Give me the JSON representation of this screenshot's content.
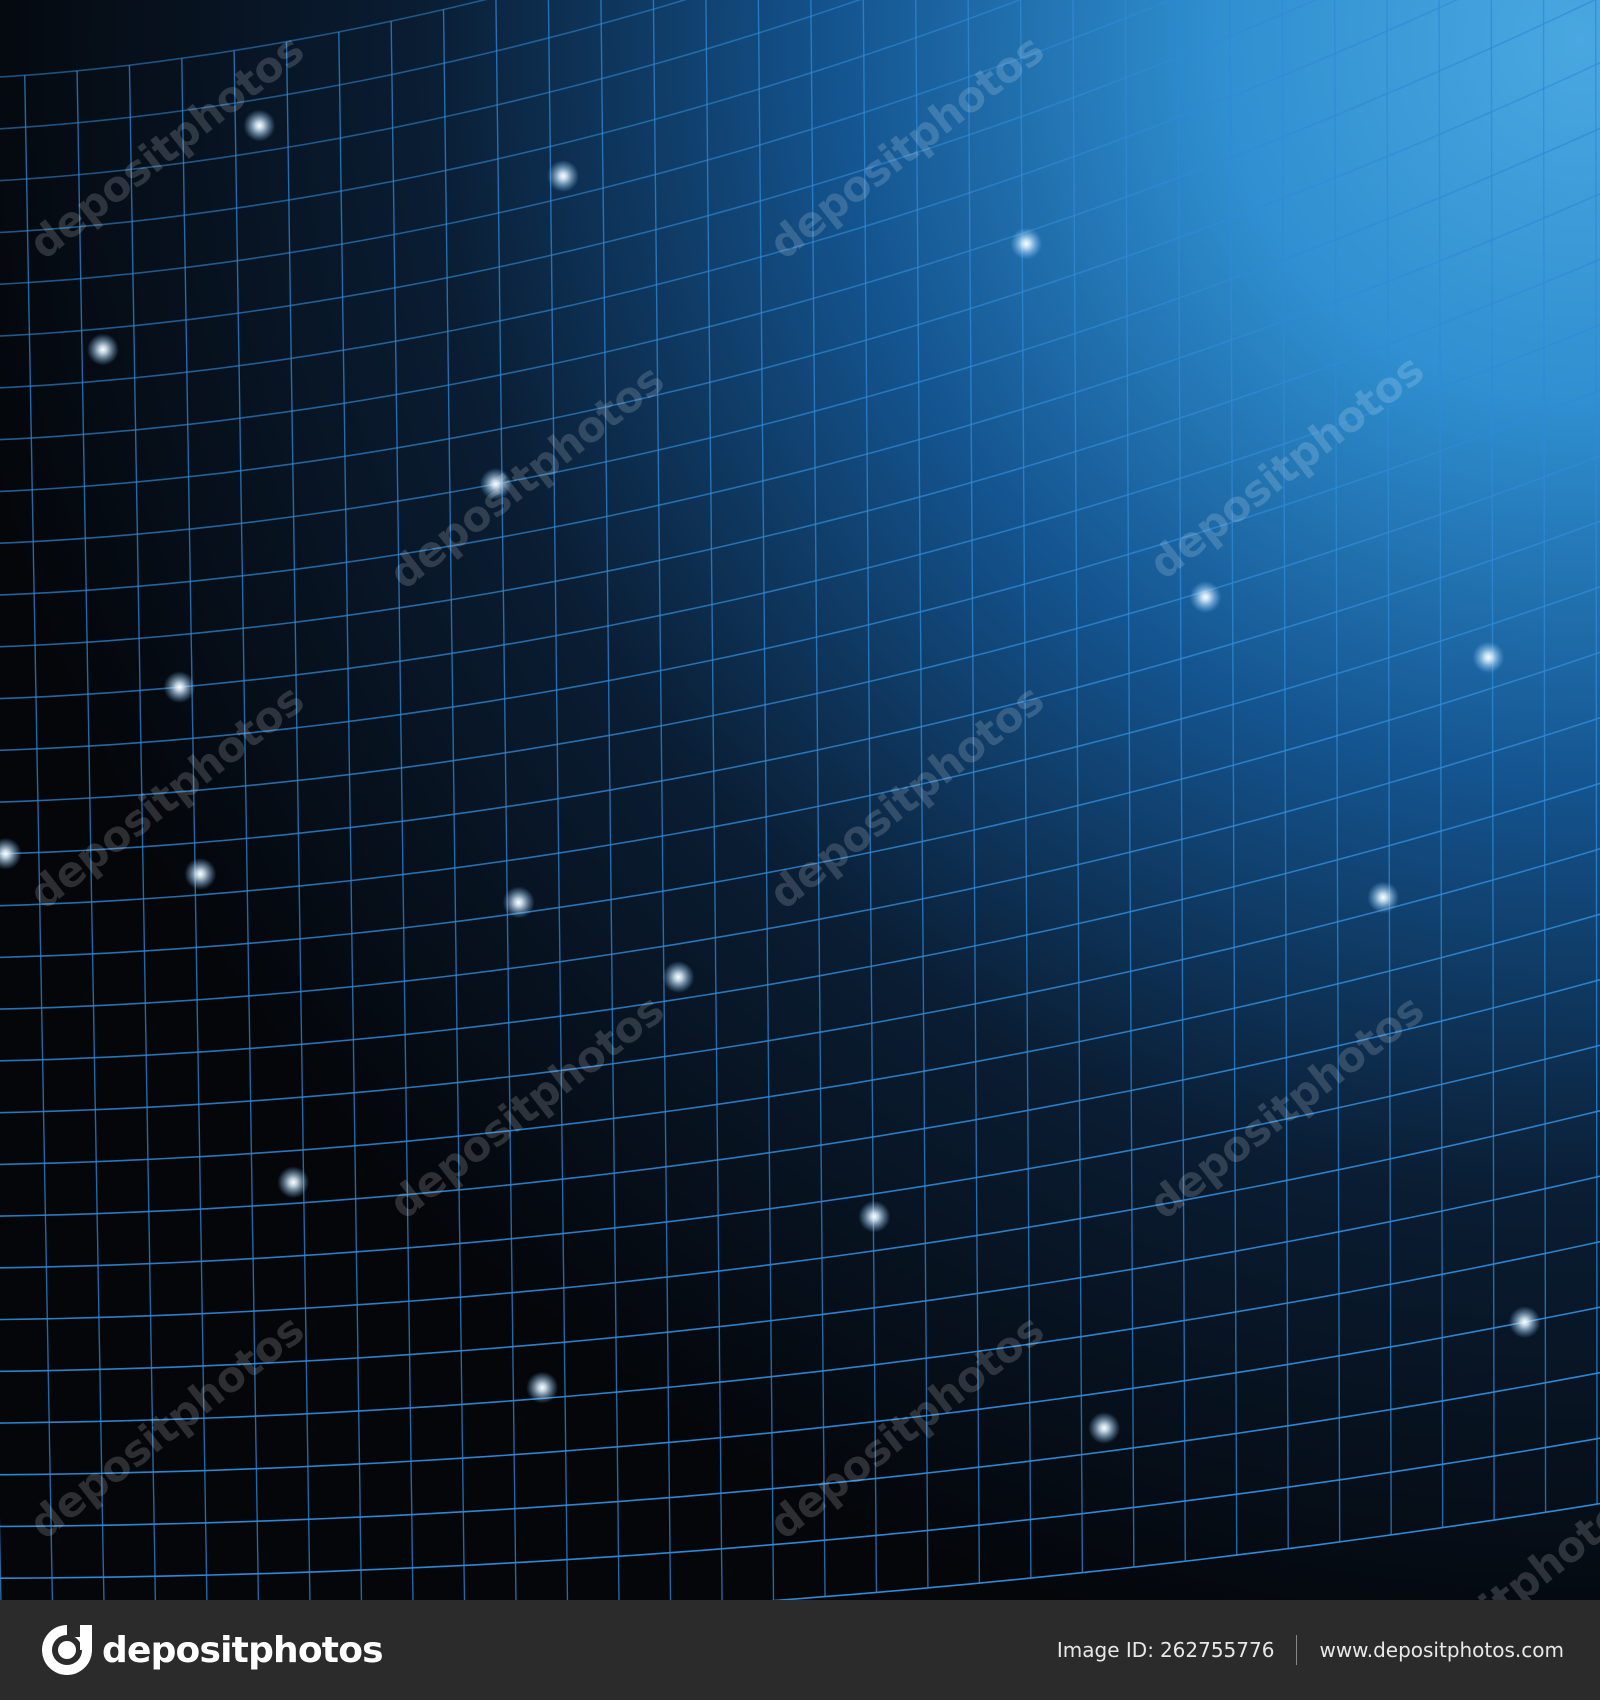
{
  "artwork": {
    "description_icon": "curved-blue-grid-with-glowing-nodes",
    "colors": {
      "dark_background": "#05070c",
      "blue_background": "#2f8fd0",
      "light_blue_corner": "#4aa7e0",
      "grid_line": "#2f8ad8",
      "glow": "#ffffff"
    }
  },
  "watermark": {
    "text": "depositphotos"
  },
  "footer": {
    "brand_name": "depositphotos",
    "brand_icon": "camera-aperture-icon",
    "image_id_label": "Image ID:",
    "image_id_value": "262755776",
    "website": "www.depositphotos.com"
  }
}
